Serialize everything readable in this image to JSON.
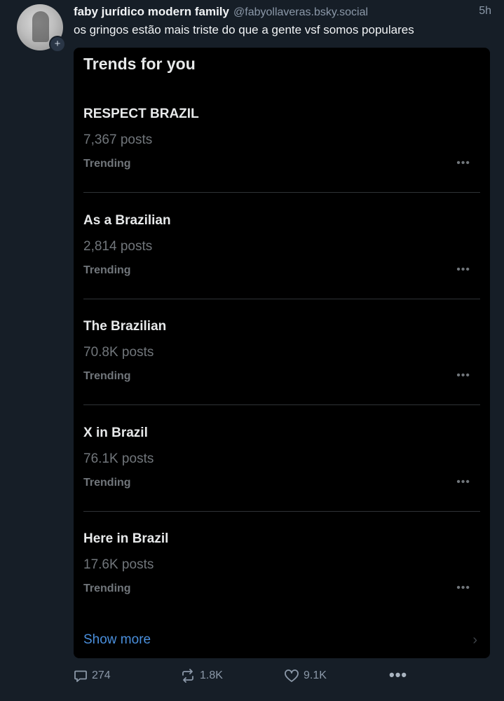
{
  "post": {
    "author_name": "faby jurídico modern family",
    "author_handle": "@fabyollaveras.bsky.social",
    "time": "5h",
    "text": "os gringos estão mais triste do que a gente vsf somos populares",
    "follow_symbol": "+"
  },
  "embed": {
    "title": "Trends for you",
    "trends": [
      {
        "name": "RESPECT BRAZIL",
        "count": "7,367 posts",
        "label": "Trending",
        "more": "•••"
      },
      {
        "name": "As a Brazilian",
        "count": "2,814 posts",
        "label": "Trending",
        "more": "•••"
      },
      {
        "name": "The Brazilian",
        "count": "70.8K posts",
        "label": "Trending",
        "more": "•••"
      },
      {
        "name": "X in Brazil",
        "count": "76.1K posts",
        "label": "Trending",
        "more": "•••"
      },
      {
        "name": "Here in Brazil",
        "count": "17.6K posts",
        "label": "Trending",
        "more": "•••"
      }
    ],
    "show_more": "Show more",
    "chevron": "›"
  },
  "actions": {
    "replies": "274",
    "reposts": "1.8K",
    "likes": "9.1K",
    "more": "•••"
  },
  "colors": {
    "background": "#161e27",
    "card": "#000000",
    "link": "#4a8fdc",
    "muted": "#8b98a8"
  }
}
